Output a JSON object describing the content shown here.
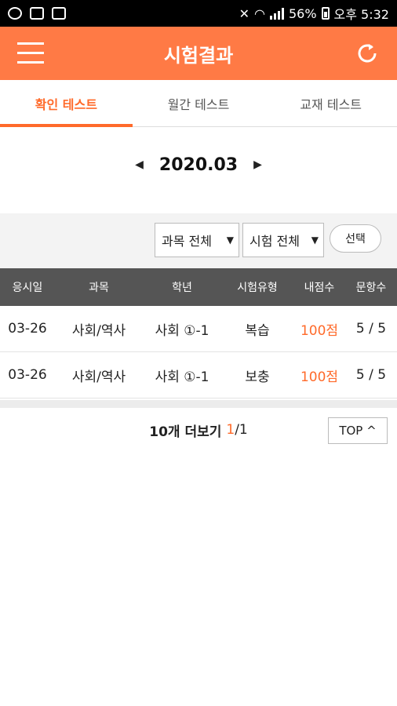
{
  "status": {
    "battery": "56%",
    "time": "오후 5:32"
  },
  "appbar": {
    "title": "시험결과"
  },
  "tabs": [
    {
      "label": "확인 테스트"
    },
    {
      "label": "월간 테스트"
    },
    {
      "label": "교재 테스트"
    }
  ],
  "month": {
    "value": "2020.03"
  },
  "filters": {
    "subject": "과목 전체",
    "test": "시험 전체",
    "select_label": "선택"
  },
  "table": {
    "headers": [
      "응시일",
      "과목",
      "학년",
      "시험유형",
      "내점수",
      "문항수"
    ],
    "rows": [
      {
        "date": "03-26",
        "subject": "사회/역사",
        "grade": "사회 ①-1",
        "type": "복습",
        "score": "100점",
        "items": "5 / 5"
      },
      {
        "date": "03-26",
        "subject": "사회/역사",
        "grade": "사회 ①-1",
        "type": "보충",
        "score": "100점",
        "items": "5 / 5"
      }
    ]
  },
  "more": {
    "label": "10개 더보기",
    "current": "1",
    "total": "/1"
  },
  "top_label": "TOP ^"
}
